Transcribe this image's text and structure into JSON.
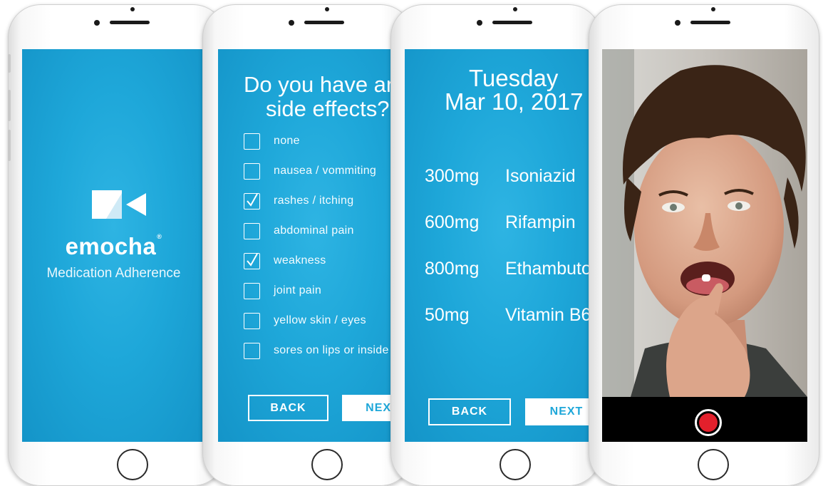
{
  "splash": {
    "brand": "emocha",
    "trademark": "®",
    "tagline": "Medication Adherence",
    "icon": "video-camera-icon"
  },
  "side_effects": {
    "question_line1": "Do you have any",
    "question_line2": "side effects?",
    "options": [
      {
        "label": "none",
        "checked": false
      },
      {
        "label": "nausea / vommiting",
        "checked": false
      },
      {
        "label": "rashes / itching",
        "checked": true
      },
      {
        "label": "abdominal pain",
        "checked": false
      },
      {
        "label": "weakness",
        "checked": true
      },
      {
        "label": "joint pain",
        "checked": false
      },
      {
        "label": "yellow skin / eyes",
        "checked": false
      },
      {
        "label": "sores on lips or inside mouth",
        "checked": false
      }
    ],
    "back_label": "BACK",
    "next_label": "NEXT"
  },
  "schedule": {
    "day": "Tuesday",
    "date": "Mar 10, 2017",
    "medications": [
      {
        "dose": "300mg",
        "name": "Isoniazid"
      },
      {
        "dose": "600mg",
        "name": "Rifampin"
      },
      {
        "dose": "800mg",
        "name": "Ethambutol"
      },
      {
        "dose": "50mg",
        "name": "Vitamin B6"
      }
    ],
    "back_label": "BACK",
    "next_label": "NEXT"
  },
  "recording": {
    "record_icon": "record-icon",
    "accent": "#e3202c"
  },
  "colors": {
    "screen_blue": "#1ea7d9",
    "white": "#ffffff"
  }
}
